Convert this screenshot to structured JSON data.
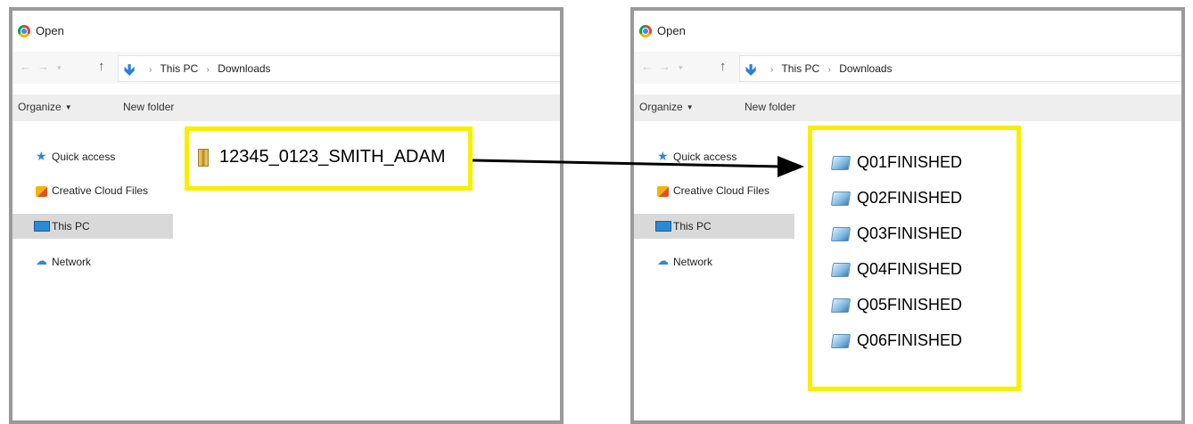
{
  "left_dialog": {
    "title": "Open",
    "breadcrumb": [
      "This PC",
      "Downloads"
    ],
    "toolbar": {
      "organize": "Organize",
      "new_folder": "New folder"
    },
    "nav_items": [
      {
        "label": "Quick access",
        "icon": "star-icon"
      },
      {
        "label": "Creative Cloud Files",
        "icon": "creative-cloud-icon"
      },
      {
        "label": "This PC",
        "icon": "this-pc-icon",
        "selected": true
      },
      {
        "label": "Network",
        "icon": "network-icon"
      }
    ],
    "highlighted_file": {
      "name": "12345_0123_SMITH_ADAM",
      "icon": "zip-folder-icon"
    }
  },
  "right_dialog": {
    "title": "Open",
    "breadcrumb": [
      "This PC",
      "Downloads"
    ],
    "toolbar": {
      "organize": "Organize",
      "new_folder": "New folder"
    },
    "nav_items": [
      {
        "label": "Quick access",
        "icon": "star-icon"
      },
      {
        "label": "Creative Cloud Files",
        "icon": "creative-cloud-icon"
      },
      {
        "label": "This PC",
        "icon": "this-pc-icon",
        "selected": true
      },
      {
        "label": "Network",
        "icon": "network-icon"
      }
    ],
    "files": [
      {
        "name": "Q01FINISHED",
        "icon": "file-icon"
      },
      {
        "name": "Q02FINISHED",
        "icon": "file-icon"
      },
      {
        "name": "Q03FINISHED",
        "icon": "file-icon"
      },
      {
        "name": "Q04FINISHED",
        "icon": "file-icon"
      },
      {
        "name": "Q05FINISHED",
        "icon": "file-icon"
      },
      {
        "name": "Q06FINISHED",
        "icon": "file-icon"
      }
    ]
  },
  "colors": {
    "highlight": "#f7ef00",
    "panel_border": "#9a9a9a",
    "arrow": "#000000",
    "selected_nav": "#d9d9d9"
  }
}
